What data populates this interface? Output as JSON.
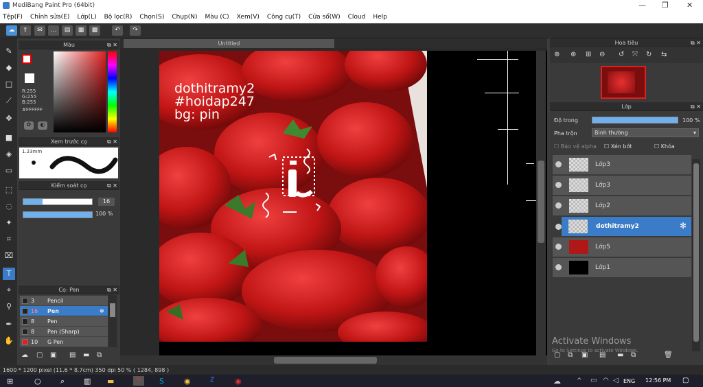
{
  "window": {
    "title": "MediBang Paint Pro (64bit)",
    "minimize": "—",
    "maximize": "❐",
    "close": "✕"
  },
  "menu": [
    "Tệp(F)",
    "Chỉnh sửa(E)",
    "Lớp(L)",
    "Bộ lọc(R)",
    "Chọn(S)",
    "Chụp(N)",
    "Màu (C)",
    "Xem(V)",
    "Công cụ(T)",
    "Cửa sổ(W)",
    "Cloud",
    "Help"
  ],
  "color_panel": {
    "title": "Màu",
    "r": "R:255",
    "g": "G:255",
    "b": "B:255",
    "hex": "#FFFFFF"
  },
  "preview_panel": {
    "title": "Xem trước cọ",
    "size": "1.23mm"
  },
  "brush_control": {
    "title": "Kiểm soát cọ",
    "size_value": "16",
    "opacity_value": "100 %",
    "size_fraction": 0.28,
    "opacity_fraction": 1.0
  },
  "brush_panel": {
    "title": "Cọ: Pen",
    "items": [
      {
        "size": "3",
        "name": "Pencil",
        "color": "#222222",
        "selected": false
      },
      {
        "size": "16",
        "name": "Pen",
        "color": "#222222",
        "selected": true
      },
      {
        "size": "8",
        "name": "Pen",
        "color": "#222222",
        "selected": false
      },
      {
        "size": "8",
        "name": "Pen (Sharp)",
        "color": "#222222",
        "selected": false
      },
      {
        "size": "10",
        "name": "G Pen",
        "color": "#e02020",
        "selected": false
      }
    ]
  },
  "document": {
    "tab": "Untitled",
    "overlay_lines": [
      "dothitramy2",
      "#hoidap247",
      "bg: pin"
    ]
  },
  "navigator": {
    "title": "Hoa tiêu"
  },
  "layers_panel": {
    "title": "Lớp",
    "opacity_label": "Độ trong",
    "opacity_value": "100 %",
    "opacity_fraction": 1.0,
    "blend_label": "Pha trộn",
    "blend_value": "Bình thường",
    "checks": [
      "Bảo vệ alpha",
      "Xén bớt",
      "Khóa"
    ],
    "layers": [
      {
        "name": "Lớp3",
        "selected": false
      },
      {
        "name": "Lớp3",
        "selected": false
      },
      {
        "name": "Lớp2",
        "selected": false
      },
      {
        "name": "dothitramy2",
        "selected": true
      },
      {
        "name": "Lớp5",
        "selected": false
      },
      {
        "name": "Lớp1",
        "selected": false
      }
    ]
  },
  "watermark": {
    "line1": "Activate Windows",
    "line2": "Go to Settings to activate Windows."
  },
  "status": {
    "text": "1600 * 1200 pixel   (11.6 * 8.7cm)   350 dpi   50 %   ( 1284, 898 )"
  },
  "taskbar": {
    "time": "12:56 PM",
    "lang": "ENG"
  }
}
